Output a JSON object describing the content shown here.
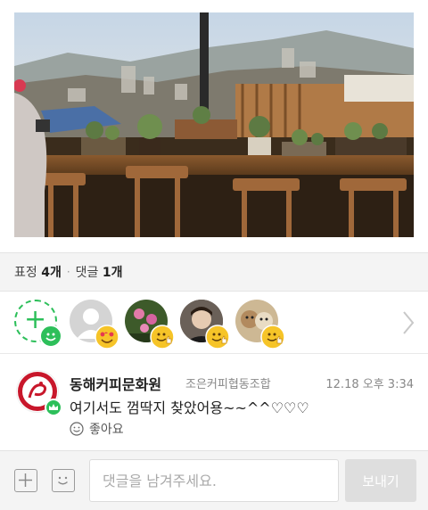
{
  "photo": {
    "alt_icon": "cafe-window-view-photo"
  },
  "summary": {
    "reactions_label": "표정",
    "reactions_count": "4개",
    "comments_label": "댓글",
    "comments_count": "1개",
    "separator": "·"
  },
  "reactors": [
    {
      "name": "reactor-1",
      "emoji": "heart-eyes-emoji"
    },
    {
      "name": "reactor-2",
      "emoji": "thumbs-up-emoji"
    },
    {
      "name": "reactor-3",
      "emoji": "thumbs-up-emoji"
    },
    {
      "name": "reactor-4",
      "emoji": "thumbs-up-emoji"
    }
  ],
  "comment": {
    "author": "동해커피문화원",
    "subtitle": "조은커피협동조합",
    "time": "12.18 오후 3:34",
    "text": "여기서도 껌딱지 찾았어용~~^^♡♡♡",
    "like_label": "좋아요",
    "badge_icon": "crown-icon"
  },
  "input": {
    "placeholder": "댓글을 남겨주세요.",
    "send_label": "보내기"
  },
  "colors": {
    "accent": "#2dbf5a",
    "emoji_yellow": "#f6c428"
  }
}
